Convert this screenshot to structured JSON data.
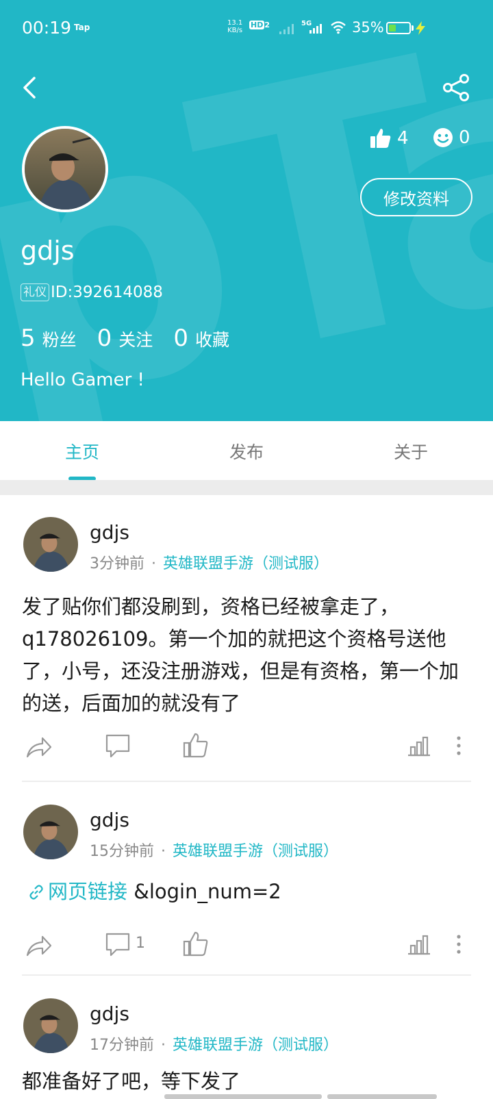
{
  "status_bar": {
    "time": "00:19",
    "tap_label": "Tap",
    "net_speed_value": "13.1",
    "net_speed_unit": "KB/s",
    "hd_label": "HD",
    "hd_sub": "2",
    "network_label": "5G",
    "battery_percent": "35%",
    "battery_level": 0.35
  },
  "profile": {
    "username": "gdjs",
    "badge": "礼仪",
    "user_id": "ID:392614088",
    "likes": "4",
    "smiles": "0",
    "edit_button": "修改资料",
    "followers_count": "5",
    "followers_label": "粉丝",
    "following_count": "0",
    "following_label": "关注",
    "favorites_count": "0",
    "favorites_label": "收藏",
    "bio": "Hello Gamer !"
  },
  "tabs": [
    {
      "label": "主页",
      "active": true
    },
    {
      "label": "发布",
      "active": false
    },
    {
      "label": "关于",
      "active": false
    }
  ],
  "posts": [
    {
      "author": "gdjs",
      "time": "3分钟前",
      "separator": "·",
      "game": "英雄联盟手游（测试服）",
      "content": "发了贴你们都没刷到，资格已经被拿走了，q178026109。第一个加的就把这个资格号送他了，小号，还没注册游戏，但是有资格，第一个加的送，后面加的就没有了",
      "comment_count": ""
    },
    {
      "author": "gdjs",
      "time": "15分钟前",
      "separator": "·",
      "game": "英雄联盟手游（测试服）",
      "link_label": "网页链接",
      "content": "&login_num=2",
      "comment_count": "1"
    },
    {
      "author": "gdjs",
      "time": "17分钟前",
      "separator": "·",
      "game": "英雄联盟手游（测试服）",
      "content": "都准备好了吧，等下发了"
    }
  ],
  "colors": {
    "accent": "#21b7c6",
    "header_bg": "#21b7c6",
    "muted_text": "#888888"
  },
  "icons": {
    "back": "chevron-left-icon",
    "share": "share-icon",
    "like": "thumbs-up-icon",
    "smile": "smile-icon",
    "forward": "forward-icon",
    "comment": "comment-icon",
    "stats": "bar-chart-icon",
    "more": "more-vertical-icon",
    "link": "link-icon"
  }
}
